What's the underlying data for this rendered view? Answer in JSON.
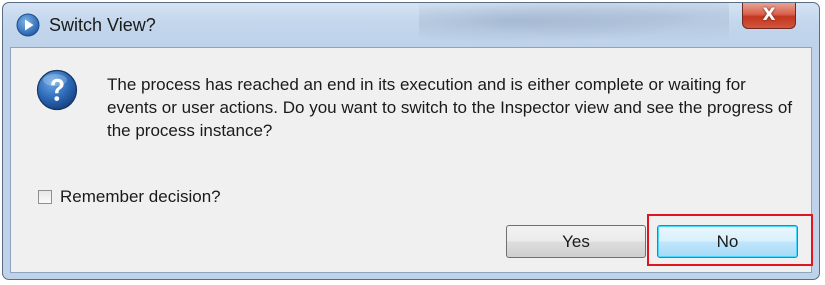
{
  "dialog": {
    "title": "Switch View?",
    "close_label": "X",
    "message": "The process has reached an end in its execution and is either complete or waiting for events or user actions. Do you want to switch to the Inspector view and see the progress of the process instance?",
    "remember_checkbox": {
      "label": "Remember decision?",
      "checked": false
    },
    "buttons": {
      "yes_label": "Yes",
      "no_label": "No"
    },
    "icons": {
      "title": "app-icon",
      "message": "question-icon"
    },
    "colors": {
      "highlight": "#e0141e",
      "close_button": "#c2361f",
      "default_button_border": "#3c7fb1"
    }
  }
}
